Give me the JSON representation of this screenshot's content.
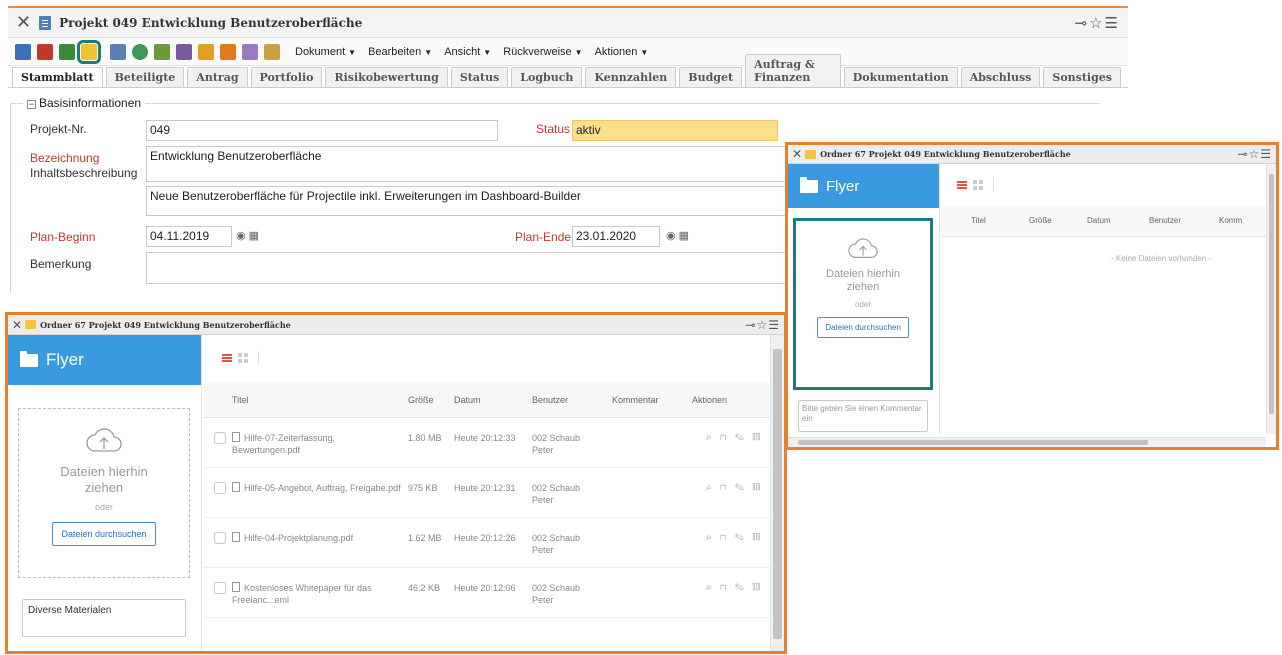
{
  "main": {
    "title": "Projekt 049 Entwicklung Benutzeroberfläche",
    "menus": [
      "Dokument",
      "Bearbeiten",
      "Ansicht",
      "Rückverweise",
      "Aktionen"
    ],
    "tabs": [
      "Stammblatt",
      "Beteiligte",
      "Antrag",
      "Portfolio",
      "Risikobewertung",
      "Status",
      "Logbuch",
      "Kennzahlen",
      "Budget",
      "Auftrag & Finanzen",
      "Dokumentation",
      "Abschluss",
      "Sonstiges"
    ],
    "section": "Basisinformationen",
    "fields": {
      "projekt_nr_label": "Projekt-Nr.",
      "projekt_nr": "049",
      "status_label": "Status",
      "status": "aktiv",
      "bezeichnung_label": "Bezeichnung",
      "bezeichnung": "Entwicklung Benutzeroberfläche",
      "inhalt_label": "Inhaltsbeschreibung",
      "inhalt": "Neue Benutzeroberfläche für Projectile inkl. Erweiterungen im Dashboard-Builder",
      "plan_beginn_label": "Plan-Beginn",
      "plan_beginn": "04.11.2019",
      "plan_ende_label": "Plan-Ende",
      "plan_ende": "23.01.2020",
      "bemerkung_label": "Bemerkung"
    }
  },
  "popup_left": {
    "title": "Ordner 67 Projekt 049 Entwicklung Benutzeroberfläche",
    "folder": "Flyer",
    "drop_text": "Dateien hierhin ziehen",
    "or": "oder",
    "browse": "Dateien durchsuchen",
    "comment": "Diverse Materialen",
    "columns": [
      "Titel",
      "Größe",
      "Datum",
      "Benutzer",
      "Kommentar",
      "Aktionen"
    ],
    "files": [
      {
        "title": "Hilfe-07-Zeiterfassung, Bewertungen.pdf",
        "size": "1.80 MB",
        "date": "Heute 20:12:33",
        "user": "002 Schaub Peter"
      },
      {
        "title": "Hilfe-05-Angebot, Auftrag, Freigabe.pdf",
        "size": "975 KB",
        "date": "Heute 20:12:31",
        "user": "002 Schaub Peter"
      },
      {
        "title": "Hilfe-04-Projektplanung.pdf",
        "size": "1.62 MB",
        "date": "Heute 20:12:26",
        "user": "002 Schaub Peter"
      },
      {
        "title": "Kostenloses Whitepaper für das Freelanc...eml",
        "size": "46.2 KB",
        "date": "Heute 20:12:06",
        "user": "002 Schaub Peter"
      }
    ]
  },
  "popup_right": {
    "title": "Ordner 67 Projekt 049 Entwicklung Benutzeroberfläche",
    "folder": "Flyer",
    "drop_text": "Dateien hierhin ziehen",
    "or": "oder",
    "browse": "Dateien durchsuchen",
    "comment_placeholder": "Bitte geben Sie einen Kommentar ein",
    "columns": [
      "Titel",
      "Größe",
      "Datum",
      "Benutzer",
      "Komm"
    ],
    "empty": "- Keine Dateien vorhanden -"
  },
  "colors": {
    "accent": "#3a9ae0",
    "highlight": "#e8812a",
    "teal": "#1a7c7c",
    "status": "#fcdf8a"
  }
}
